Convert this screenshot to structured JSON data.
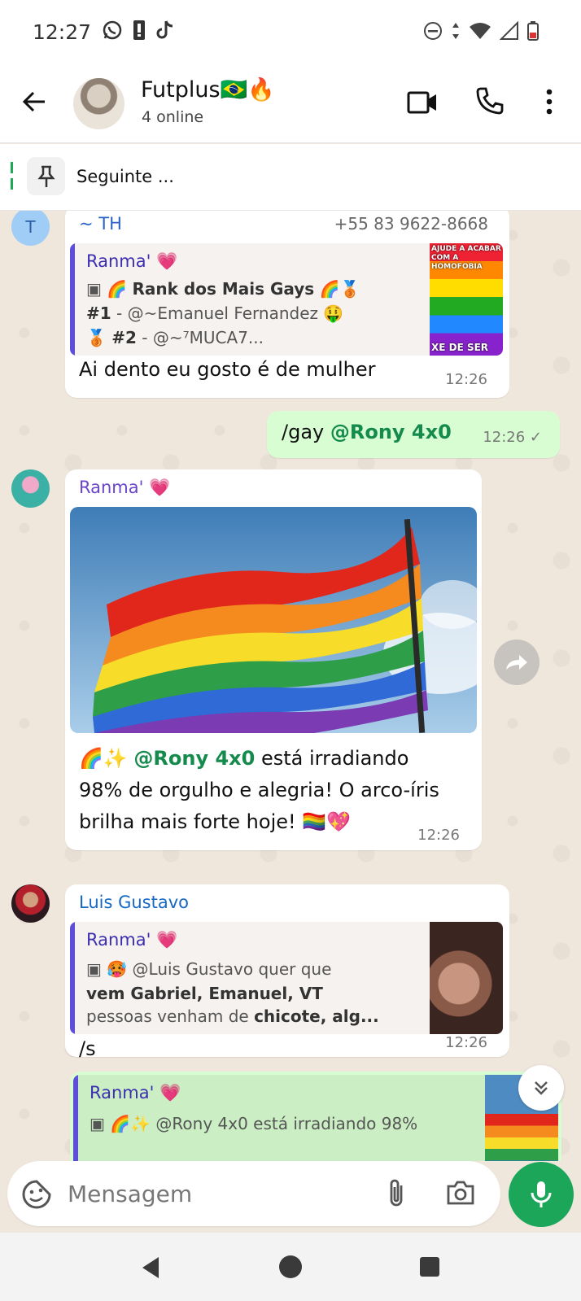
{
  "status_bar": {
    "time": "12:27"
  },
  "header": {
    "title": "Futplus🇧🇷🔥",
    "subtitle": "4 online"
  },
  "pinned": {
    "label": "Seguinte ..."
  },
  "messages": [
    {
      "sender": "~ TH",
      "avatar_letter": "T",
      "phone": "+55 83 9622-8668",
      "reply": {
        "name": "Ranma' 💗",
        "line1_prefix": "🌈",
        "line1_bold": "Rank dos Mais Gays",
        "line1_suffix": "🌈🥉",
        "line2_bold": "#1",
        "line2_text": " - @~Emanuel Fernandez 🤑",
        "line3_prefix": "🥉",
        "line3_bold": "#2",
        "line3_text": " - @~⁷MUCA7...",
        "thumb_caption_top": "AJUDE A ACABAR COM A HOMOFOBIA",
        "thumb_caption_bottom": "XE DE SER"
      },
      "text": "Ai dento eu gosto é de mulher",
      "time": "12:26"
    },
    {
      "outgoing": true,
      "text_prefix": "/gay ",
      "mention": "@Rony 4x0",
      "time": "12:26 ✓"
    },
    {
      "sender": "Ranma' 💗",
      "text_line1_prefix": "🌈✨ ",
      "mention": "@Rony 4x0",
      "text_line1_suffix": " está irradiando",
      "text_line2": "98% de orgulho e alegria! O arco-íris",
      "text_line3": "brilha mais forte hoje! 🏳️‍🌈💖",
      "time": "12:26"
    },
    {
      "sender": "Luis Gustavo",
      "reply": {
        "name": "Ranma' 💗",
        "line1": "🥵 @Luis Gustavo quer que",
        "line2_bold": "vem Gabriel, Emanuel, VT",
        "line3_text": "pessoas venham de ",
        "line3_bold": "chicote, alg..."
      },
      "text": "/s",
      "time": "12:26"
    },
    {
      "outgoing": true,
      "reply": {
        "name": "Ranma' 💗",
        "line1": "🌈✨ @Rony 4x0 está irradiando 98%"
      }
    }
  ],
  "input": {
    "placeholder": "Mensagem"
  },
  "colors": {
    "accent": "#1ba65a",
    "outgoing_bubble": "#d9fdd3",
    "reply_bar": "#5e4fd8",
    "mention": "#148a4c"
  },
  "icons": [
    "whatsapp-icon",
    "sim-icon",
    "tiktok-icon",
    "dnd-icon",
    "data-icon",
    "wifi-icon",
    "signal-icon",
    "battery-icon",
    "back-arrow-icon",
    "video-call-icon",
    "voice-call-icon",
    "more-vert-icon",
    "pin-icon",
    "forward-icon",
    "scroll-down-icon",
    "emoji-icon",
    "attach-icon",
    "camera-icon",
    "mic-icon",
    "nav-back-icon",
    "nav-home-icon",
    "nav-recents-icon"
  ]
}
